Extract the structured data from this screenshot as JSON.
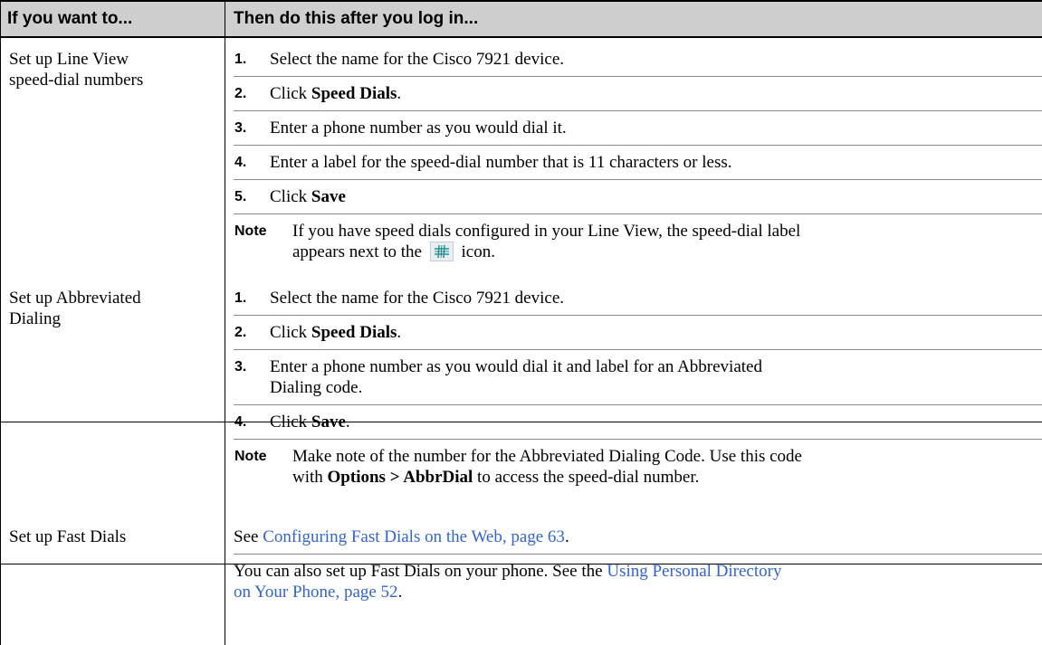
{
  "header": {
    "col1": "If you want to...",
    "col2": "Then do this after you log in..."
  },
  "rows": [
    {
      "task_line1": "Set up Line View",
      "task_line2": "speed-dial numbers",
      "steps": [
        {
          "num": "1.",
          "pre": "Select the name for the Cisco 7921 device.",
          "bold": "",
          "post": ""
        },
        {
          "num": "2.",
          "pre": "Click ",
          "bold": "Speed Dials",
          "post": "."
        },
        {
          "num": "3.",
          "pre": "Enter a phone number as you would dial it.",
          "bold": "",
          "post": ""
        },
        {
          "num": "4.",
          "pre": "Enter a label for the speed-dial number that is 11 characters or less.",
          "bold": "",
          "post": ""
        },
        {
          "num": "5.",
          "pre": "Click ",
          "bold": "Save",
          "post": ""
        }
      ],
      "note_label": "Note",
      "note_line1": "If you have speed dials configured in your Line View, the speed-dial label",
      "note_line2_pre": "appears next to the",
      "note_line2_post": "icon.",
      "note_icon": "speed-dial-grid-icon"
    },
    {
      "task_line1": "Set up Abbreviated",
      "task_line2": "Dialing",
      "steps": [
        {
          "num": "1.",
          "pre": "Select the name for the Cisco 7921 device.",
          "bold": "",
          "post": ""
        },
        {
          "num": "2.",
          "pre": "Click ",
          "bold": "Speed Dials",
          "post": "."
        },
        {
          "num": "3.",
          "pre": "Enter a phone number as you would dial it and label for an Abbreviated",
          "bold": "",
          "post": ""
        },
        {
          "num": "",
          "pre": "Dialing code.",
          "bold": "",
          "post": ""
        },
        {
          "num": "4.",
          "pre": "Click ",
          "bold": "Save",
          "post": "."
        }
      ],
      "note_label": "Note",
      "note_line1": "Make note of the number for the Abbreviated Dialing Code. Use this code",
      "note_line2_pre": "with",
      "note_line2_bold1": "Options > AbbrDial",
      "note_line2_post": "to access the speed-dial number."
    },
    {
      "task_line1": "Set up Fast Dials",
      "p1_pre": "See ",
      "p1_link": "Configuring Fast Dials on the Web, page 63",
      "p1_post": ".",
      "p2_line1_pre": "You can also set up Fast Dials on your phone. See the ",
      "p2_line1_link": "Using Personal Directory",
      "p2_line2_link": "on Your Phone, page 52",
      "p2_line2_post": "."
    }
  ],
  "colors": {
    "header_bg": "#cfcfcf",
    "link": "#3366cc"
  }
}
